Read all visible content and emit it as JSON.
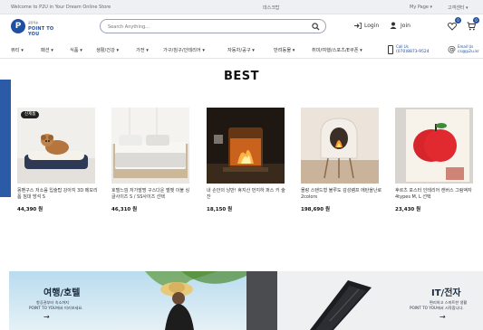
{
  "topbar": {
    "welcome": "Welcome to P2U in Your Dream Online Store",
    "center_link": "데스크탑",
    "my_page": "My Page ▾",
    "customer_center": "고객센터 ▾"
  },
  "header": {
    "logo_mark": "P",
    "logo_small": "공장직송",
    "logo_text": "POINT TO YOU",
    "search_placeholder": "Search Anything...",
    "login_label": "Login",
    "join_label": "Join",
    "wishlist_count": "0",
    "cart_count": "0"
  },
  "nav": {
    "categories": [
      "뷰티 ▾",
      "패션 ▾",
      "식품 ▾",
      "생활/건강 ▾",
      "가전 ▾",
      "가구/침구/인테리어 ▾",
      "자동차/공구 ▾",
      "반려동물 ▾",
      "취미/여행/스포츠/E쿠폰 ▾"
    ],
    "call_label": "Call Us",
    "call_value": "(070)8873-9524",
    "email_label": "Email Us",
    "email_value": "cs@p2u.kr"
  },
  "best": {
    "title": "BEST",
    "products": [
      {
        "tag": "신제품",
        "name": "몽펜구스 저소음 입술탑 강아지 3D 메모리폼 침대 방석 S",
        "price": "44,390 원"
      },
      {
        "tag": "",
        "name": "호텔느낌 저가발명 구스다운 벨벳 이불 싱글사이즈 S / SS사이즈 선택",
        "price": "46,310 원"
      },
      {
        "tag": "",
        "name": "내 손안의 낭만! 휴지산 먼지하 퍼스 키 술잔",
        "price": "18,150 원"
      },
      {
        "tag": "",
        "name": "몰랑 스탠드형 불루도 감성램프 에탄올난로 2colors",
        "price": "198,690 원"
      },
      {
        "tag": "",
        "name": "후르츠 포스터 인테리어 캔버스 그림액자 4types M, L 선택",
        "price": "23,430 원"
      }
    ]
  },
  "banners": [
    {
      "title": "여행/호텔",
      "sub_line1": "항공권부터 숙소까지",
      "sub_line2": "POINT TO YOU에서 미리보세요.",
      "arrow": "→"
    },
    {
      "title": "IT/전자",
      "sub_line1": "편리하고 스마트한 생활",
      "sub_line2": "POINT TO YOU에서 시작합니다.",
      "arrow": "→"
    }
  ],
  "colors": {
    "brand": "#1f4fa0",
    "accent_bar": "#2b5aa6"
  }
}
